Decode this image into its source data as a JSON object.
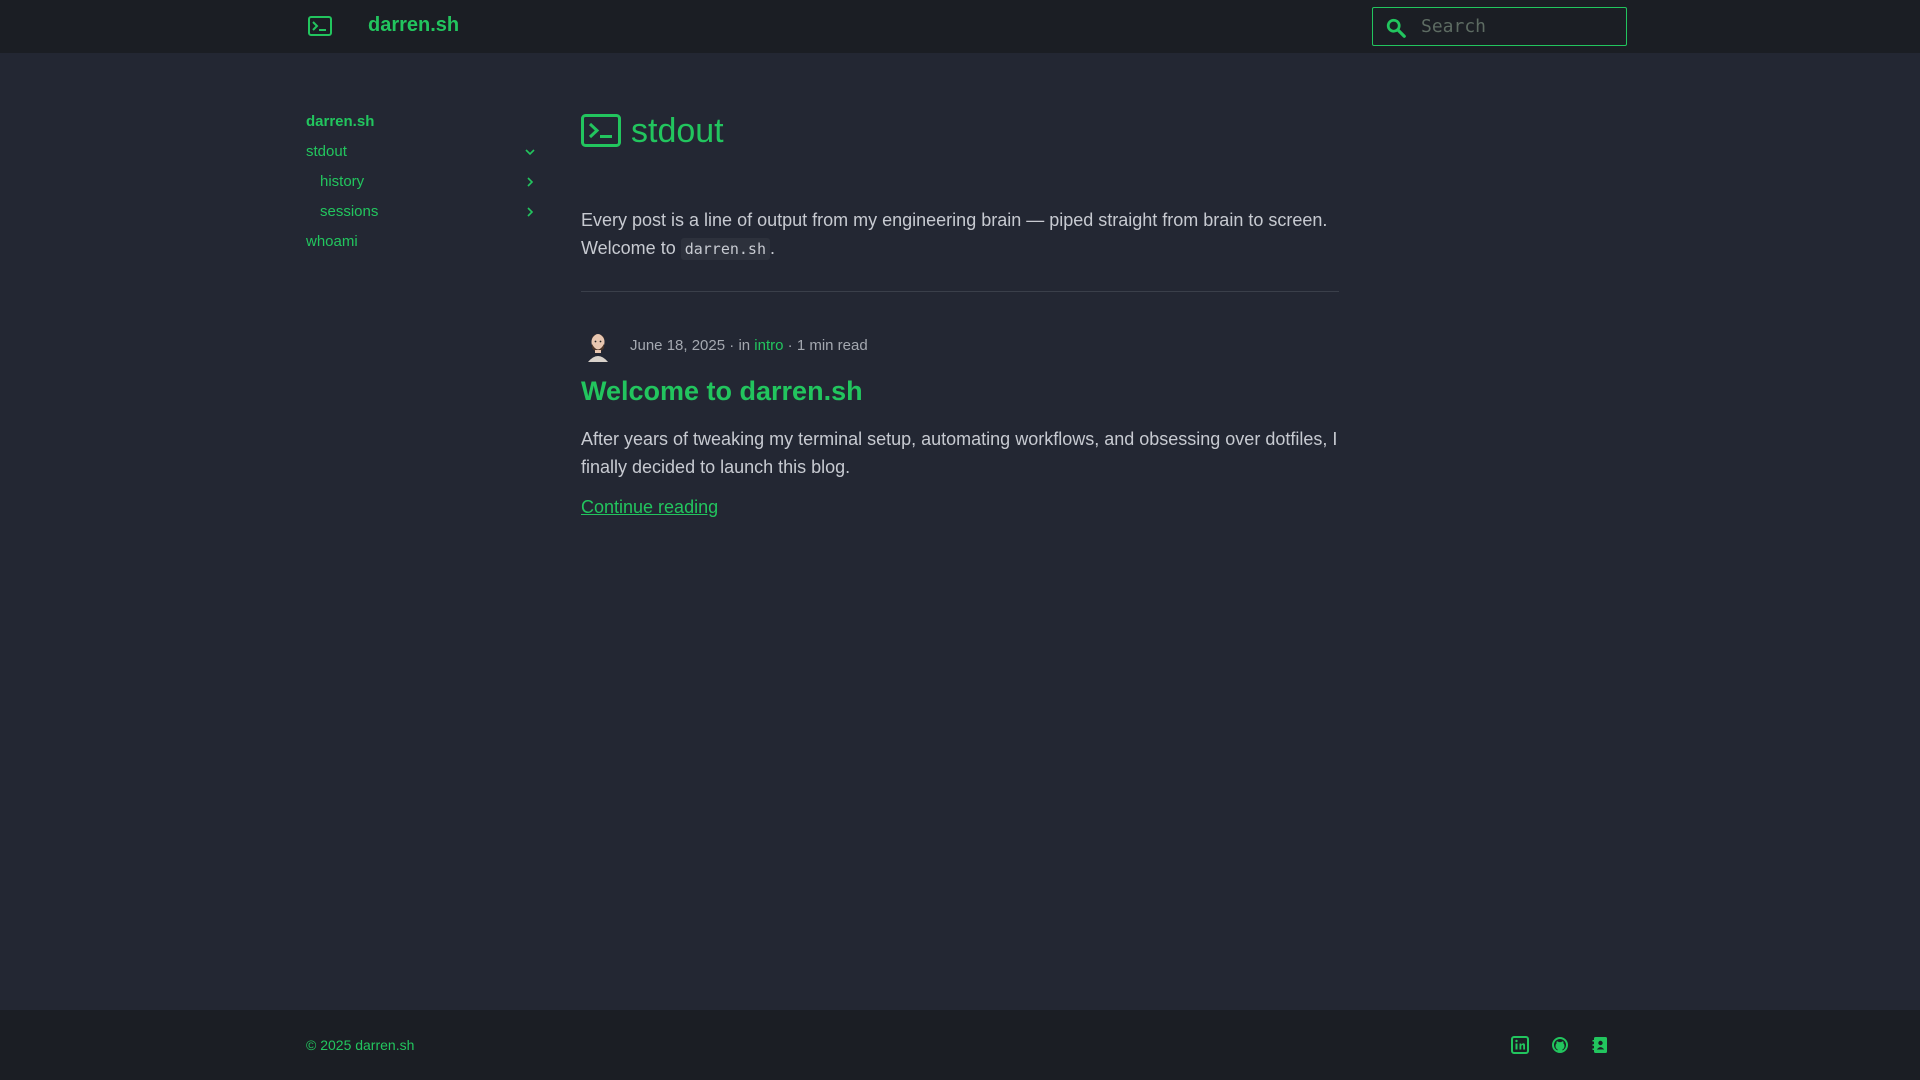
{
  "header": {
    "site_title": "darren.sh",
    "search_placeholder": "Search"
  },
  "sidebar": {
    "items": [
      {
        "label": "darren.sh"
      },
      {
        "label": "stdout"
      },
      {
        "label": "history"
      },
      {
        "label": "sessions"
      },
      {
        "label": "whoami"
      }
    ]
  },
  "main": {
    "title": "stdout",
    "intro_text": "Every post is a line of output from my engineering brain — piped straight from brain to screen. Welcome to ",
    "intro_code": "darren.sh",
    "intro_end": ".",
    "post": {
      "date": "June 18, 2025",
      "in_label": "in",
      "category": "intro",
      "read_time": "1 min read",
      "title": "Welcome to darren.sh",
      "excerpt": "After years of tweaking my terminal setup, automating workflows, and obsessing over dotfiles, I finally decided to launch this blog.",
      "continue_label": "Continue reading"
    }
  },
  "footer": {
    "copyright": "© 2025 darren.sh",
    "social_icons": [
      "linkedin-icon",
      "github-icon",
      "contact-card-icon"
    ]
  },
  "colors": {
    "accent": "#22c55e",
    "background": "#232733",
    "bar": "#1b1e24",
    "text": "#c7cad1",
    "muted": "#a4a8b0"
  }
}
